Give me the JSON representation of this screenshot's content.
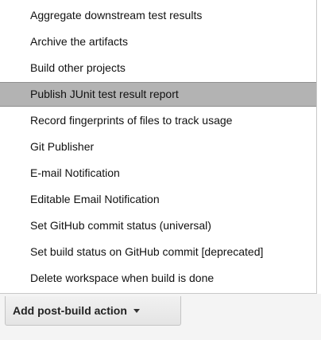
{
  "menu": {
    "items": [
      {
        "label": "Aggregate downstream test results",
        "highlighted": false
      },
      {
        "label": "Archive the artifacts",
        "highlighted": false
      },
      {
        "label": "Build other projects",
        "highlighted": false
      },
      {
        "label": "Publish JUnit test result report",
        "highlighted": true
      },
      {
        "label": "Record fingerprints of files to track usage",
        "highlighted": false
      },
      {
        "label": "Git Publisher",
        "highlighted": false
      },
      {
        "label": "E-mail Notification",
        "highlighted": false
      },
      {
        "label": "Editable Email Notification",
        "highlighted": false
      },
      {
        "label": "Set GitHub commit status (universal)",
        "highlighted": false
      },
      {
        "label": "Set build status on GitHub commit [deprecated]",
        "highlighted": false
      },
      {
        "label": "Delete workspace when build is done",
        "highlighted": false
      }
    ]
  },
  "add_action": {
    "label": "Add post-build action",
    "icon": "chevron-down-icon"
  }
}
